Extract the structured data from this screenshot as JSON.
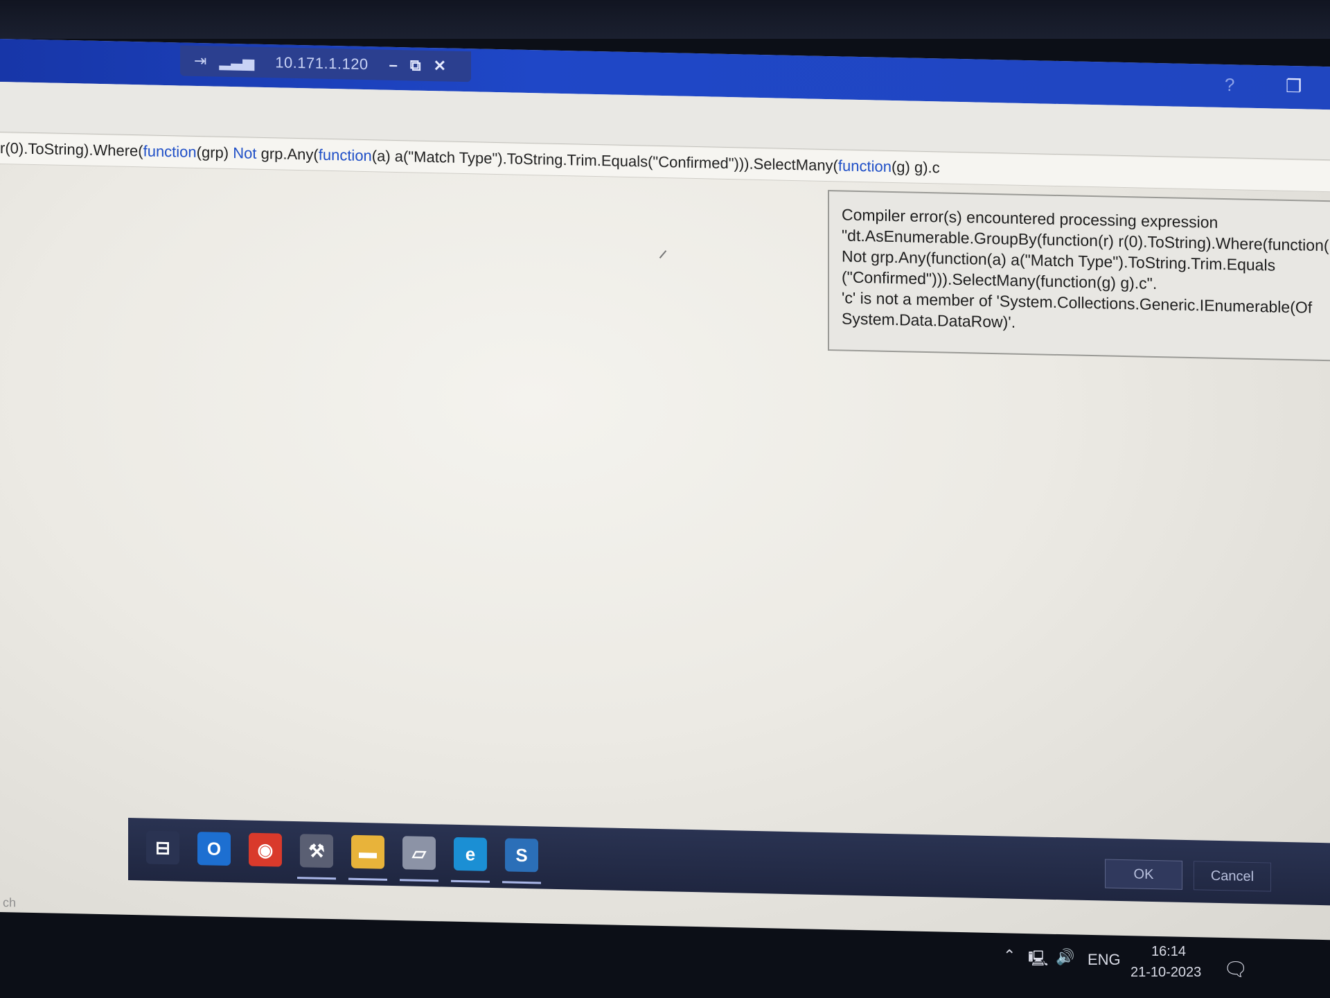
{
  "remote_bar": {
    "ip": "10.171.1.120",
    "minimize": "–",
    "restore": "⧉",
    "close": "✕",
    "pin_icon": "pin-icon",
    "signal_icon": "signal-icon",
    "help": "?",
    "window_icon": "window-restore-icon"
  },
  "expression_bar": {
    "parts": [
      {
        "text": "r(0).ToString).Where(",
        "kw": false
      },
      {
        "text": "function",
        "kw": true
      },
      {
        "text": "(grp) ",
        "kw": false
      },
      {
        "text": "Not",
        "kw": true
      },
      {
        "text": " grp.Any(",
        "kw": false
      },
      {
        "text": "function",
        "kw": true
      },
      {
        "text": "(a) a(\"Match Type\").ToString.Trim.Equals(\"Confirmed\"))).SelectMany(",
        "kw": false
      },
      {
        "text": "function",
        "kw": true
      },
      {
        "text": "(g) g).c",
        "kw": false
      }
    ]
  },
  "error_tooltip": {
    "lines": [
      "Compiler error(s) encountered processing expression",
      "\"dt.AsEnumerable.GroupBy(function(r) r(0).ToString).Where(function(",
      "Not grp.Any(function(a) a(\"Match Type\").ToString.Trim.Equals",
      "(\"Confirmed\"))).SelectMany(function(g) g).c\".",
      "'c' is not a member of 'System.Collections.Generic.IEnumerable(Of",
      "System.Data.DataRow)'."
    ]
  },
  "taskbar": {
    "icons": [
      {
        "name": "task-view-icon",
        "glyph": "⊟",
        "color": "#2a3352"
      },
      {
        "name": "outlook-icon",
        "glyph": "O",
        "color": "#1d6fd1"
      },
      {
        "name": "chrome-icon",
        "glyph": "◉",
        "color": "#d93a2b"
      },
      {
        "name": "tools-icon",
        "glyph": "⚒",
        "color": "#5a5f73"
      },
      {
        "name": "file-explorer-icon",
        "glyph": "▬",
        "color": "#e8b33a"
      },
      {
        "name": "notepad-icon",
        "glyph": "▱",
        "color": "#8c93a6"
      },
      {
        "name": "edge-icon",
        "glyph": "e",
        "color": "#1b8fd4"
      },
      {
        "name": "studio-icon",
        "glyph": "S",
        "color": "#2b6fb8"
      }
    ],
    "search_snippet": "ch"
  },
  "dialog_buttons": {
    "ok": "OK",
    "cancel": "Cancel"
  },
  "tray": {
    "language": "ENG",
    "time": "16:14",
    "date": "21-10-2023",
    "icons": [
      "chevron-up-icon",
      "network-icon",
      "volume-icon",
      "notification-icon"
    ]
  },
  "colors": {
    "keyword": "#1f4fc7",
    "rdp_bar": "#1f47c7",
    "taskbar": "#2a3352"
  }
}
